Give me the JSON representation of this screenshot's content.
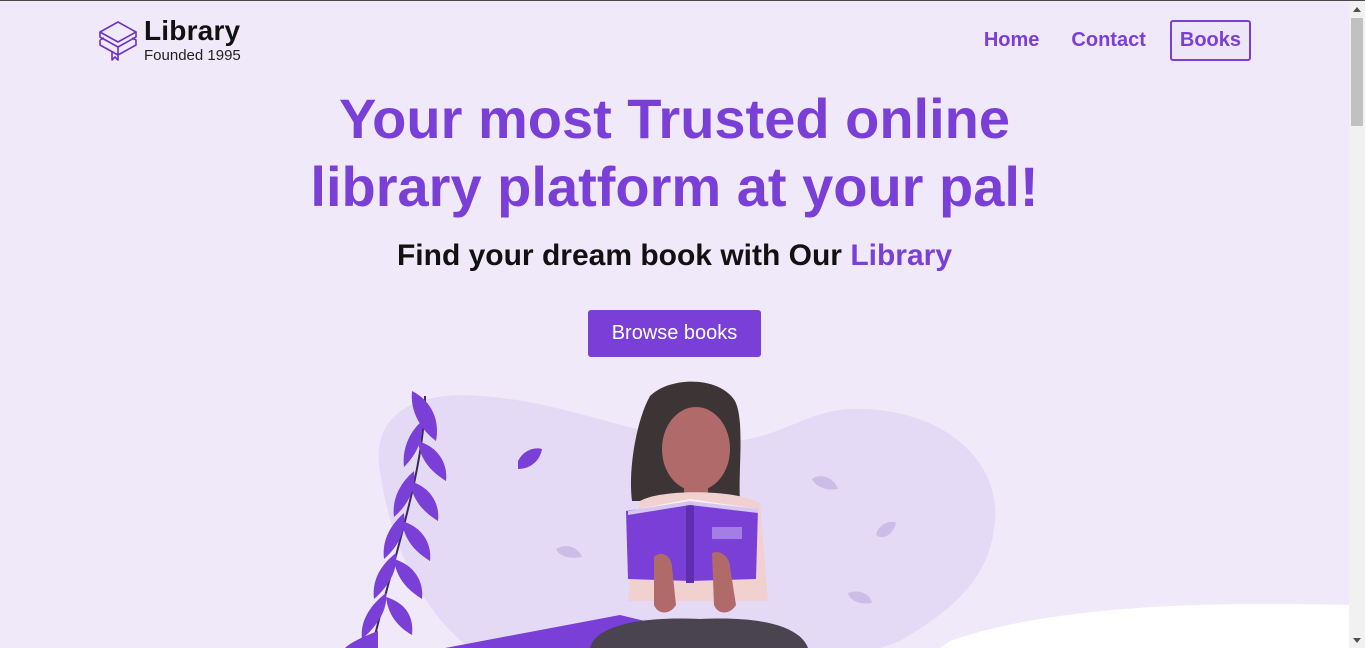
{
  "brand": {
    "title": "Library",
    "subtitle": "Founded 1995",
    "icon": "stacked-books-icon"
  },
  "nav": {
    "items": [
      {
        "label": "Home",
        "active": false
      },
      {
        "label": "Contact",
        "active": false
      },
      {
        "label": "Books",
        "active": true
      }
    ]
  },
  "hero": {
    "title_line1": "Your most Trusted online",
    "title_line2": "library platform at your pal!",
    "subtitle_prefix": "Find your dream book with Our ",
    "subtitle_accent": "Library",
    "button_label": "Browse books"
  },
  "colors": {
    "accent": "#7a3fd6",
    "background_tint": "#efe9fa",
    "blob": "#e4daf5"
  },
  "illustration": "woman-reading-book-illustration"
}
